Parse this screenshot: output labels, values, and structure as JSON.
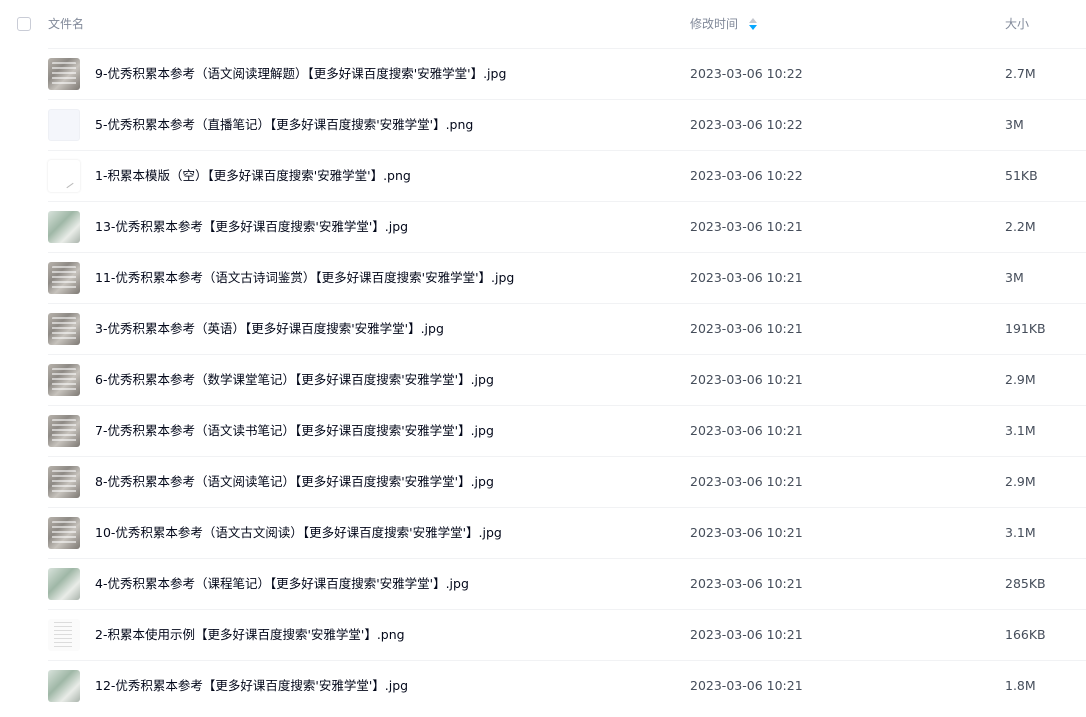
{
  "header": {
    "name_label": "文件名",
    "time_label": "修改时间",
    "size_label": "大小",
    "sort_icon": "sort-desc-icon",
    "sort_active_color": "#06a7ff"
  },
  "files": [
    {
      "name": "9-优秀积累本参考（语文阅读理解题）【更多好课百度搜索'安雅学堂'】.jpg",
      "time": "2023-03-06 10:22",
      "size": "2.7M",
      "thumb": "photo"
    },
    {
      "name": "5-优秀积累本参考（直播笔记）【更多好课百度搜索'安雅学堂'】.png",
      "time": "2023-03-06 10:22",
      "size": "3M",
      "thumb": "light"
    },
    {
      "name": "1-积累本模版（空）【更多好课百度搜索'安雅学堂'】.png",
      "time": "2023-03-06 10:22",
      "size": "51KB",
      "thumb": "blank"
    },
    {
      "name": "13-优秀积累本参考【更多好课百度搜索'安雅学堂'】.jpg",
      "time": "2023-03-06 10:21",
      "size": "2.2M",
      "thumb": "green"
    },
    {
      "name": "11-优秀积累本参考（语文古诗词鉴赏）【更多好课百度搜索'安雅学堂'】.jpg",
      "time": "2023-03-06 10:21",
      "size": "3M",
      "thumb": "photo"
    },
    {
      "name": "3-优秀积累本参考（英语）【更多好课百度搜索'安雅学堂'】.jpg",
      "time": "2023-03-06 10:21",
      "size": "191KB",
      "thumb": "photo"
    },
    {
      "name": "6-优秀积累本参考（数学课堂笔记）【更多好课百度搜索'安雅学堂'】.jpg",
      "time": "2023-03-06 10:21",
      "size": "2.9M",
      "thumb": "photo"
    },
    {
      "name": "7-优秀积累本参考（语文读书笔记）【更多好课百度搜索'安雅学堂'】.jpg",
      "time": "2023-03-06 10:21",
      "size": "3.1M",
      "thumb": "photo"
    },
    {
      "name": "8-优秀积累本参考（语文阅读笔记）【更多好课百度搜索'安雅学堂'】.jpg",
      "time": "2023-03-06 10:21",
      "size": "2.9M",
      "thumb": "photo"
    },
    {
      "name": "10-优秀积累本参考（语文古文阅读）【更多好课百度搜索'安雅学堂'】.jpg",
      "time": "2023-03-06 10:21",
      "size": "3.1M",
      "thumb": "photo"
    },
    {
      "name": "4-优秀积累本参考（课程笔记）【更多好课百度搜索'安雅学堂'】.jpg",
      "time": "2023-03-06 10:21",
      "size": "285KB",
      "thumb": "green"
    },
    {
      "name": "2-积累本使用示例【更多好课百度搜索'安雅学堂'】.png",
      "time": "2023-03-06 10:21",
      "size": "166KB",
      "thumb": "sketch"
    },
    {
      "name": "12-优秀积累本参考【更多好课百度搜索'安雅学堂'】.jpg",
      "time": "2023-03-06 10:21",
      "size": "1.8M",
      "thumb": "green"
    }
  ]
}
